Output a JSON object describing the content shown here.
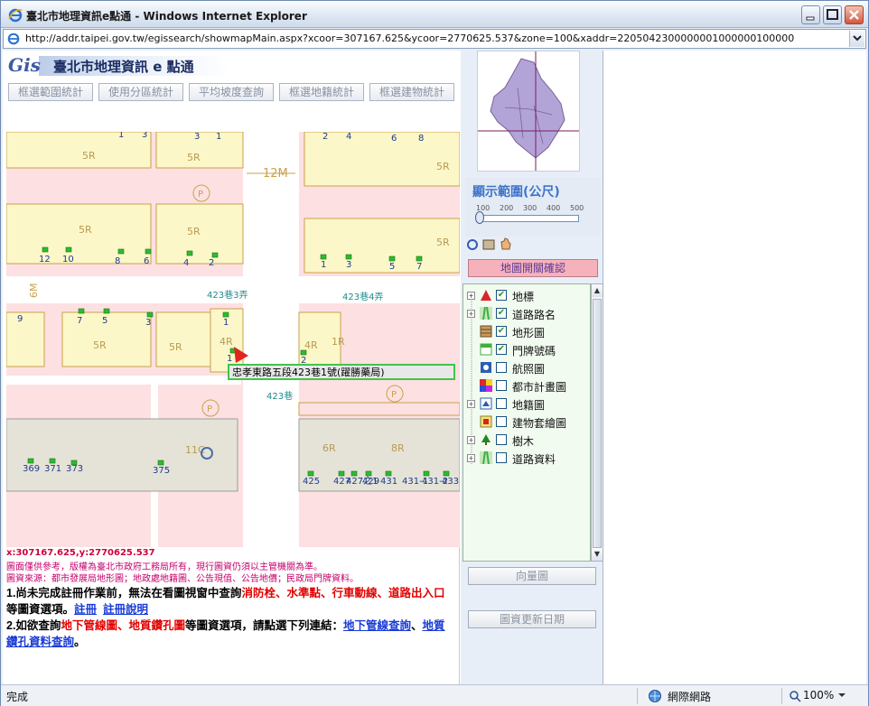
{
  "window": {
    "title": "臺北市地理資訊e點通 - Windows Internet Explorer",
    "url": "http://addr.taipei.gov.tw/egissearch/showmapMain.aspx?xcoor=307167.625&ycoor=2770625.537&zone=100&xaddr=2205042300000001000000100000"
  },
  "banner": {
    "logo": "Gis",
    "title": "臺北市地理資訊 e 點通"
  },
  "toolbar": [
    "框選範圍統計",
    "使用分區統計",
    "平均坡度查詢",
    "框選地籍統計",
    "框選建物統計"
  ],
  "map": {
    "road_width": "12M",
    "road_width_left": "6M",
    "address_box": "忠孝東路五段423巷1號(躍勝藥局)",
    "lane_labels": [
      "423巷3弄",
      "423巷4弄",
      "423巷"
    ],
    "floor_labels": [
      "5R",
      "5R",
      "5R",
      "5R",
      "5R",
      "5R",
      "5R",
      "5R",
      "4R",
      "4R",
      "1R",
      "11C",
      "6R",
      "8R"
    ],
    "door_numbers_top": [
      "3",
      "1",
      "2",
      "4",
      "6",
      "8",
      "3",
      "1"
    ],
    "door_numbers_row2": [
      "12",
      "10",
      "8",
      "6",
      "4",
      "2",
      "1",
      "3",
      "5",
      "7"
    ],
    "door_numbers_row3": [
      "9",
      "7",
      "5",
      "3",
      "1",
      "1",
      "2"
    ],
    "door_numbers_bottom": [
      "369",
      "371",
      "373",
      "375",
      "425",
      "427",
      "427之1",
      "429",
      "431",
      "431-1",
      "431-2",
      "433"
    ],
    "parking": "P"
  },
  "coords": "x:307167.625,y:2770625.537",
  "notes": [
    "圖面僅供參考，版權為臺北市政府工務局所有，現行圖資仍須以主管機關為準。",
    "圖資來源：都市發展局地形圖；地政處地籍圖、公告現值、公告地價；民政局門牌資料。"
  ],
  "info": {
    "p1_a": "1.尚未完成註冊作業前，無法在看圖視窗中查詢",
    "p1_red": "消防栓、水準點、行車動線、道路出入口",
    "p1_b": "等圖資選項。",
    "p1_link1": "註冊",
    "p1_link2": "註冊說明",
    "p2_a": "2.如欲查詢",
    "p2_red": "地下管線圖、地質鑽孔圖",
    "p2_b": "等圖資選項，請點選下列連結：",
    "p2_link1": "地下管線查詢",
    "p2_sep": "、",
    "p2_link2": "地質鑽孔資料查詢",
    "p2_end": "。"
  },
  "scale": {
    "title": "顯示範圍(公尺)",
    "ticks": [
      "100",
      "200",
      "300",
      "400",
      "500"
    ],
    "value": 100
  },
  "confirm_button": "地圖開關確認",
  "layers": [
    {
      "label": "地標",
      "checked": true,
      "expandable": true,
      "icon": "landmark-icon",
      "color": "#d8262a"
    },
    {
      "label": "道路路名",
      "checked": true,
      "expandable": true,
      "icon": "road-icon",
      "color": "#3fae3f"
    },
    {
      "label": "地形圖",
      "checked": true,
      "expandable": false,
      "icon": "terrain-icon",
      "color": "#8a5a2a"
    },
    {
      "label": "門牌號碼",
      "checked": true,
      "expandable": false,
      "icon": "doorplate-icon",
      "color": "#3fae3f"
    },
    {
      "label": "航照圖",
      "checked": false,
      "expandable": false,
      "icon": "aerial-icon",
      "color": "#2b5fb0"
    },
    {
      "label": "都市計畫圖",
      "checked": false,
      "expandable": false,
      "icon": "urban-plan-icon",
      "color": "#d82b2b"
    },
    {
      "label": "地籍圖",
      "checked": false,
      "expandable": true,
      "icon": "cadastral-icon",
      "color": "#2b5fb0"
    },
    {
      "label": "建物套繪圖",
      "checked": false,
      "expandable": false,
      "icon": "building-icon",
      "color": "#e02020"
    },
    {
      "label": "樹木",
      "checked": false,
      "expandable": true,
      "icon": "tree-icon",
      "color": "#1e8a1e"
    },
    {
      "label": "道路資料",
      "checked": false,
      "expandable": true,
      "icon": "road-data-icon",
      "color": "#3fae3f"
    }
  ],
  "buttons": {
    "overview": "向量圖",
    "update_date": "圖資更新日期"
  },
  "status": {
    "left": "完成",
    "zone": "網際網路",
    "zoom": "100%"
  }
}
